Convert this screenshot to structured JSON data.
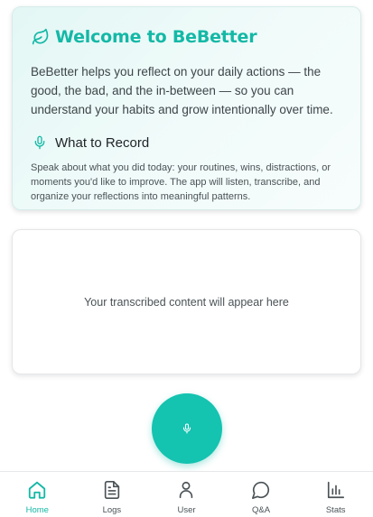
{
  "welcome": {
    "title": "Welcome to BeBetter",
    "description": "BeBetter helps you reflect on your daily actions — the good, the bad, and the in-between — so you can understand your habits and grow intentionally over time.",
    "record_title": "What to Record",
    "record_description": "Speak about what you did today: your routines, wins, distractions, or moments you'd like to improve. The app will listen, transcribe, and organize your reflections into meaningful patterns.",
    "title_icon": "leaf-icon",
    "record_icon": "mic-icon"
  },
  "transcript": {
    "placeholder": "Your transcribed content will appear here"
  },
  "record_button": {
    "icon": "mic-icon"
  },
  "nav": {
    "active": "Home",
    "items": [
      {
        "label": "Home",
        "icon": "home-icon"
      },
      {
        "label": "Logs",
        "icon": "document-icon"
      },
      {
        "label": "User",
        "icon": "user-icon"
      },
      {
        "label": "Q&A",
        "icon": "chat-bubble-icon"
      },
      {
        "label": "Stats",
        "icon": "bar-chart-icon"
      }
    ]
  },
  "colors": {
    "accent": "#14b8a6",
    "button": "#14c3b0",
    "text": "#2b2f33",
    "muted": "#4a5256"
  }
}
